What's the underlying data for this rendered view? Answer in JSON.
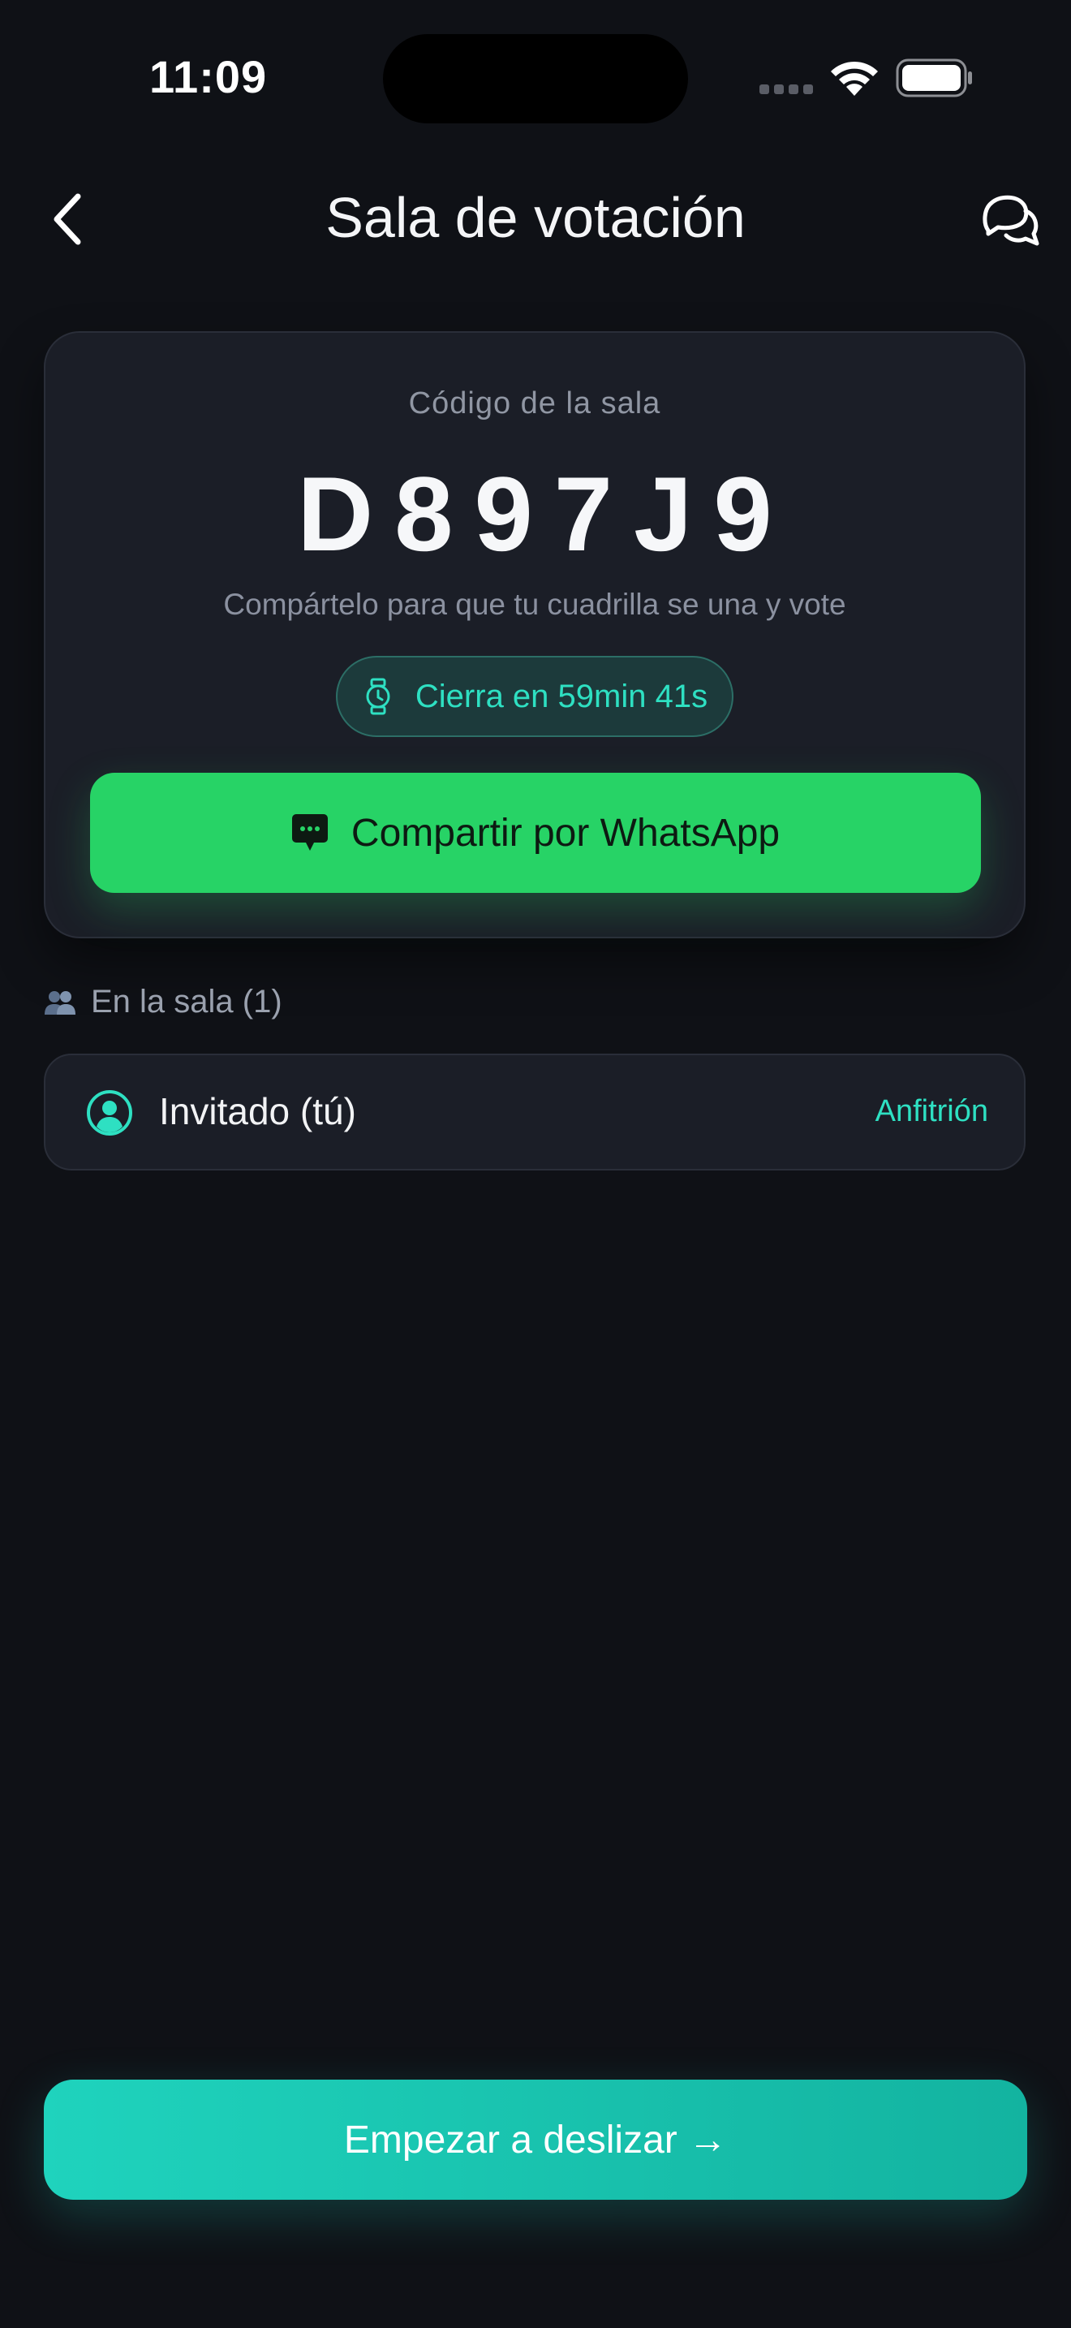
{
  "status_bar": {
    "time": "11:09",
    "icons": [
      "signal-dots-icon",
      "wifi-icon",
      "battery-icon"
    ]
  },
  "nav": {
    "back_icon": "chevron-left-icon",
    "title": "Sala de votación",
    "chat_icon": "chat-bubbles-icon"
  },
  "room_card": {
    "code_label": "Código de la sala",
    "code": "D897J9",
    "share_hint": "Compártelo para que tu cuadrilla se una y vote",
    "timer": {
      "icon": "watch-icon",
      "text": "Cierra en 59min 41s"
    },
    "whatsapp_button": {
      "icon": "message-bubble-icon",
      "label": "Compartir por WhatsApp"
    }
  },
  "members": {
    "icon": "people-icon",
    "title": "En la sala (1)",
    "items": [
      {
        "avatar_icon": "user-circle-icon",
        "name": "Invitado (tú)",
        "role": "Anfitrión"
      }
    ]
  },
  "start_button": {
    "label": "Empezar a deslizar →"
  },
  "colors": {
    "background": "#0f1116",
    "card": "#1b1e27",
    "accent": "#2ee0c2",
    "whatsapp": "#27d366",
    "start_gradient_start": "#1fd3bd",
    "start_gradient_end": "#13b3a0"
  }
}
